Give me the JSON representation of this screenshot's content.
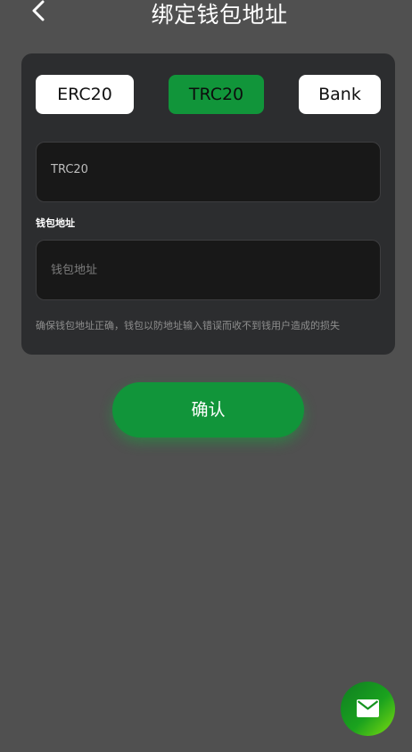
{
  "header": {
    "title": "绑定钱包地址",
    "back_icon": "chevron-left-icon"
  },
  "tabs": [
    {
      "label": "ERC20",
      "active": false
    },
    {
      "label": "TRC20",
      "active": true
    },
    {
      "label": "Bank",
      "active": false
    }
  ],
  "network_field": {
    "value": "TRC20"
  },
  "address_field": {
    "label": "钱包地址",
    "placeholder": "钱包地址",
    "value": ""
  },
  "hint": "确保钱包地址正确，钱包以防地址输入错误而收不到钱用户造成的损失",
  "confirm_label": "确认",
  "fab": {
    "icon": "mail-icon"
  },
  "colors": {
    "background": "#505050",
    "card": "#2c2d2f",
    "accent": "#11953a",
    "field": "#181818"
  }
}
